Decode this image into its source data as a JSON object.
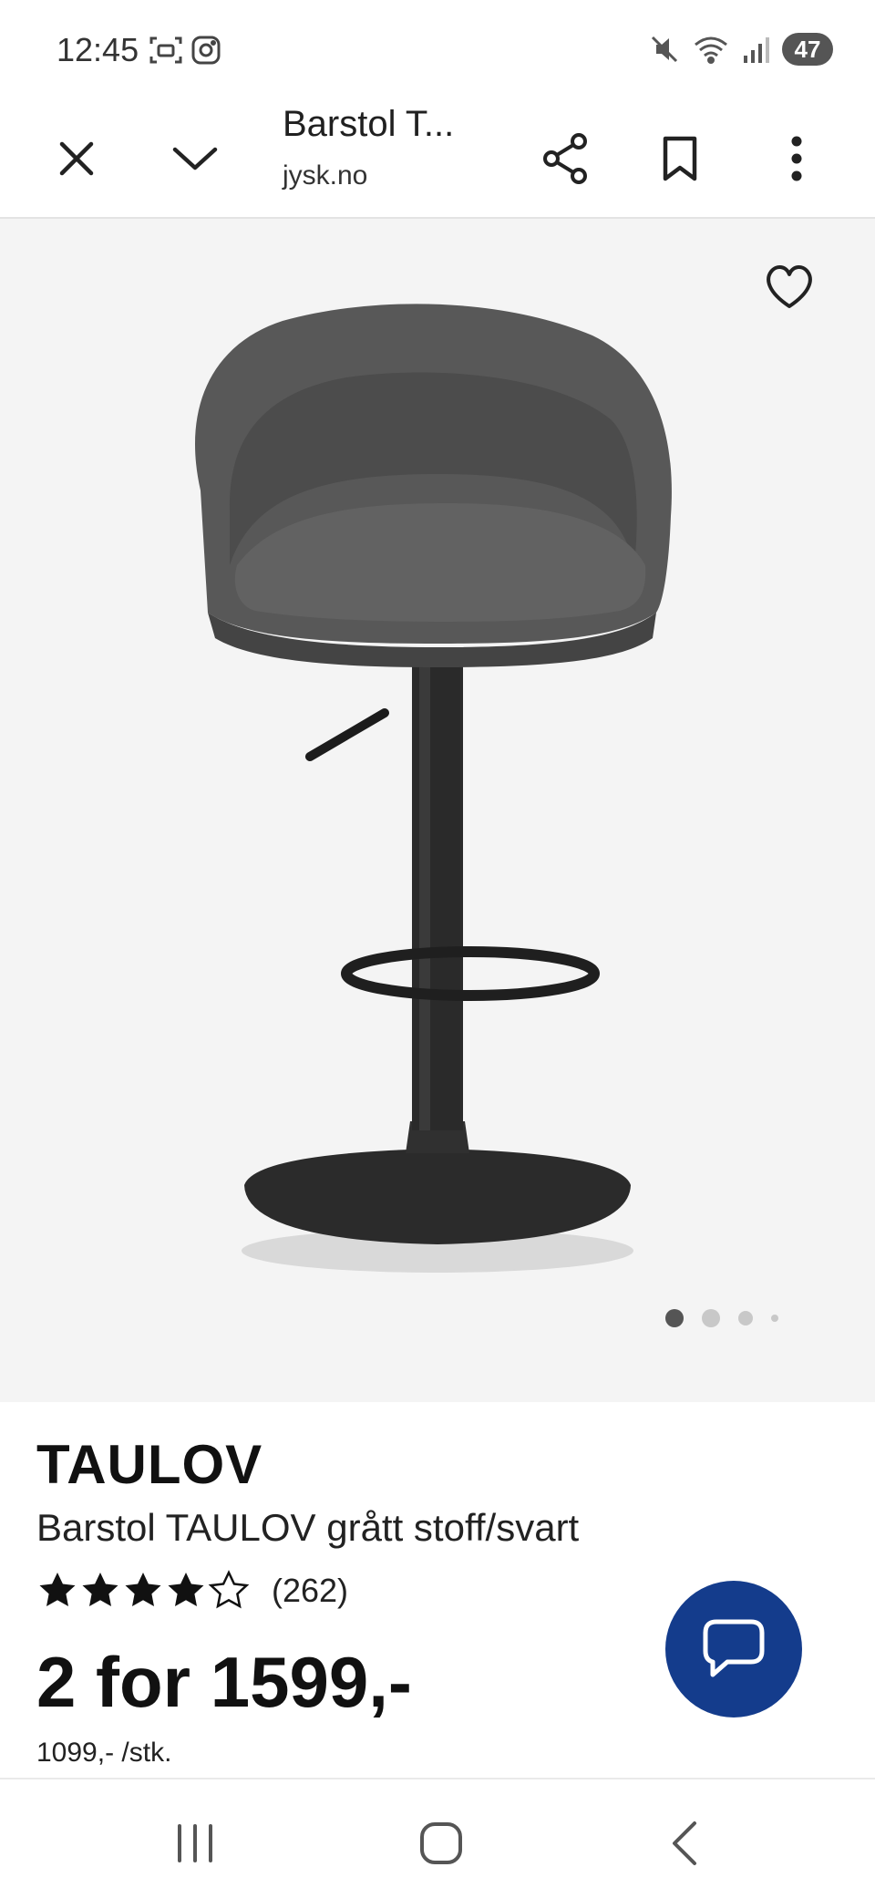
{
  "status_bar": {
    "time": "12:45",
    "battery": "47",
    "icons": [
      "screenshot-icon",
      "instagram-icon",
      "mute-icon",
      "wifi-icon",
      "signal-icon"
    ]
  },
  "toolbar": {
    "title": "Barstol T...",
    "domain": "jysk.no",
    "icons": [
      "close-icon",
      "chevron-down-icon",
      "share-icon",
      "bookmark-icon",
      "more-icon"
    ]
  },
  "gallery": {
    "image_count": 4,
    "active_index": 0,
    "favorite_icon": "heart-icon"
  },
  "product": {
    "brand": "TAULOV",
    "name": "Barstol TAULOV grått stoff/svart",
    "rating": 4,
    "rating_max": 5,
    "reviews": "(262)",
    "price": "2 for 1599,-",
    "unit_price": "1099,- /stk."
  },
  "chat_button": {
    "icon": "chat-icon",
    "color": "#143c8c"
  },
  "nav_bar": {
    "icons": [
      "recent-apps-icon",
      "home-icon",
      "back-icon"
    ]
  }
}
